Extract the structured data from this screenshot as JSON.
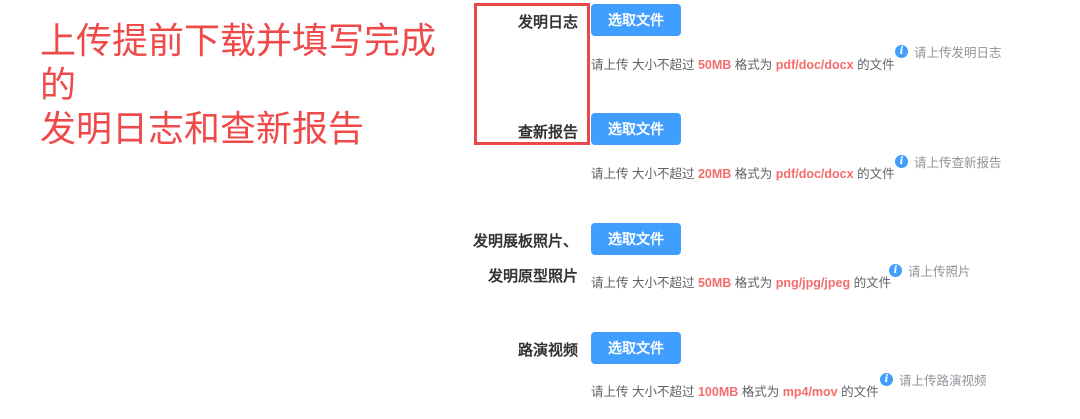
{
  "annotation": {
    "line1": "上传提前下载并填写完成的",
    "line2": "发明日志和查新报告"
  },
  "colors": {
    "accent": "#409eff",
    "highlight": "#f56c6c",
    "annotation": "#ef4a4a"
  },
  "fields": [
    {
      "label": "发明日志",
      "button": "选取文件",
      "hint_prefix": "请上传 大小不超过",
      "size": "50MB",
      "hint_mid": "格式为",
      "formats": "pdf/doc/docx",
      "hint_suffix": "的文件",
      "tip_icon": "info-icon",
      "tip": "请上传发明日志"
    },
    {
      "label": "查新报告",
      "button": "选取文件",
      "hint_prefix": "请上传 大小不超过",
      "size": "20MB",
      "hint_mid": "格式为",
      "formats": "pdf/doc/docx",
      "hint_suffix": "的文件",
      "tip_icon": "info-icon",
      "tip": "请上传查新报告"
    },
    {
      "label": "发明展板照片、",
      "label2": "发明原型照片",
      "button": "选取文件",
      "hint_prefix": "请上传 大小不超过",
      "size": "50MB",
      "hint_mid": "格式为",
      "formats": "png/jpg/jpeg",
      "hint_suffix": "的文件",
      "tip_icon": "info-icon",
      "tip": "请上传照片"
    },
    {
      "label": "路演视频",
      "button": "选取文件",
      "hint_prefix": "请上传 大小不超过",
      "size": "100MB",
      "hint_mid": "格式为",
      "formats": "mp4/mov",
      "hint_suffix": "的文件",
      "tip_icon": "info-icon",
      "tip": "请上传路演视频"
    }
  ]
}
